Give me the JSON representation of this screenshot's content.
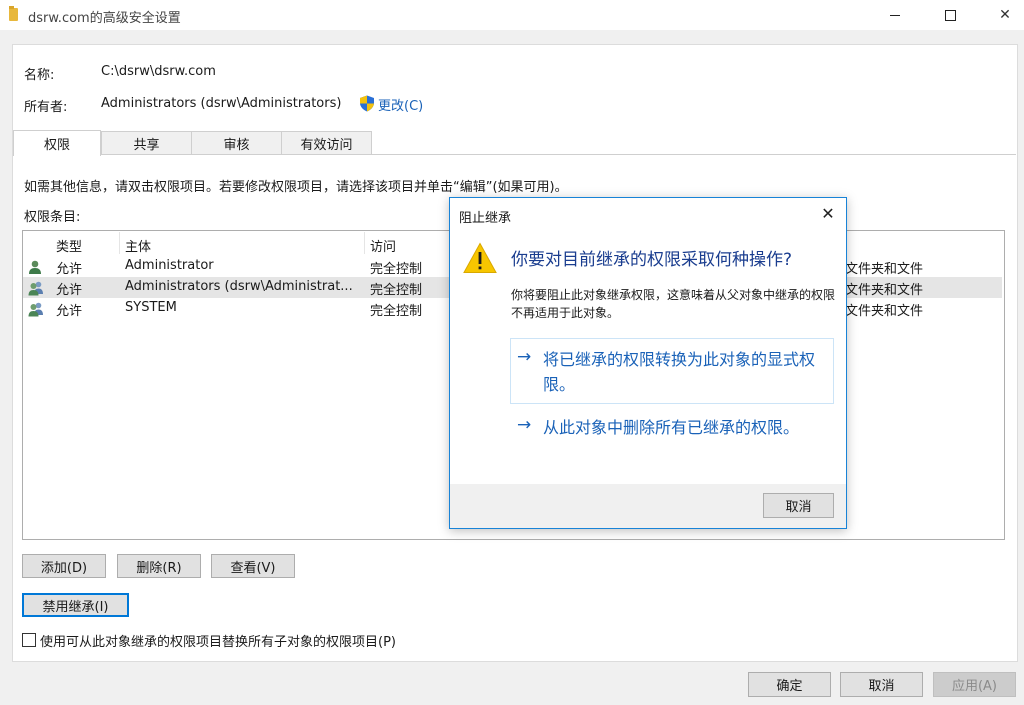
{
  "window": {
    "title": "dsrw.com的高级安全设置",
    "minimize_icon": "minimize-icon",
    "maximize_icon": "maximize-icon",
    "close_glyph": "✕"
  },
  "info": {
    "name_label": "名称:",
    "name_value": "C:\\dsrw\\dsrw.com",
    "owner_label": "所有者:",
    "owner_value": "Administrators (dsrw\\Administrators)",
    "change_link": "更改(C)"
  },
  "tabs": [
    {
      "label": "权限"
    },
    {
      "label": "共享"
    },
    {
      "label": "审核"
    },
    {
      "label": "有效访问"
    }
  ],
  "permissions": {
    "instruction": "如需其他信息，请双击权限项目。若要修改权限项目，请选择该项目并单击“编辑”(如果可用)。",
    "entries_label": "权限条目:",
    "columns": {
      "type": "类型",
      "principal": "主体",
      "access": "访问"
    },
    "rows": [
      {
        "type": "允许",
        "principal": "Administrator",
        "access": "完全控制",
        "applies": "文件夹和文件"
      },
      {
        "type": "允许",
        "principal": "Administrators (dsrw\\Administrat...",
        "access": "完全控制",
        "applies": "文件夹和文件"
      },
      {
        "type": "允许",
        "principal": "SYSTEM",
        "access": "完全控制",
        "applies": "文件夹和文件"
      }
    ]
  },
  "buttons": {
    "add": "添加(D)",
    "remove": "删除(R)",
    "view": "查看(V)",
    "disable_inheritance": "禁用继承(I)",
    "ok": "确定",
    "cancel": "取消",
    "apply": "应用(A)"
  },
  "replace_checkbox_label": "使用可从此对象继承的权限项目替换所有子对象的权限项目(P)",
  "dialog": {
    "title": "阻止继承",
    "close_glyph": "✕",
    "heading": "你要对目前继承的权限采取何种操作?",
    "description": "你将要阻止此对象继承权限，这意味着从父对象中继承的权限不再适用于此对象。",
    "option_convert": "将已继承的权限转换为此对象的显式权限。",
    "option_remove": "从此对象中删除所有已继承的权限。",
    "arrow_glyph": "→",
    "cancel": "取消"
  },
  "colors": {
    "accent": "#0078d7",
    "link": "#1a62b8",
    "heading": "#1a3d8f",
    "warning": "#f7c600"
  }
}
